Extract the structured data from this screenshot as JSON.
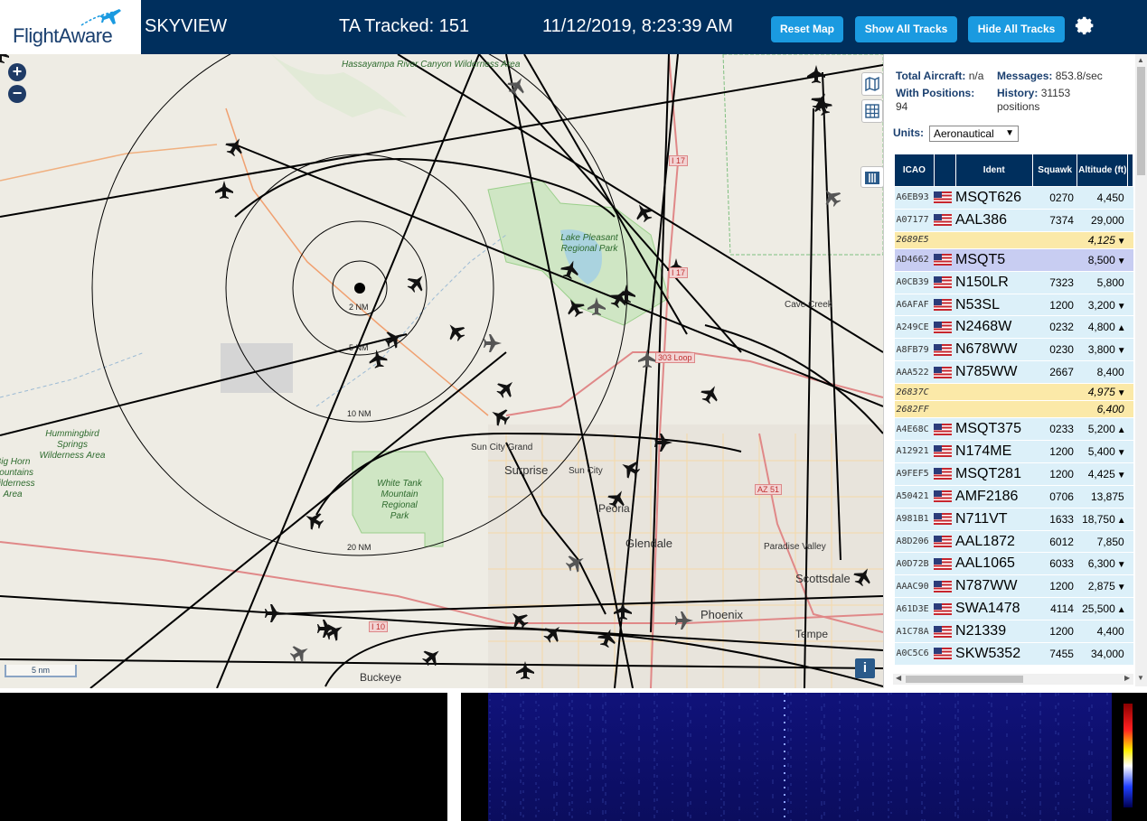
{
  "header": {
    "logo_text": "FlightAware",
    "app_name": "SKYVIEW",
    "ta_tracked": "TA Tracked: 151",
    "datetime": "11/12/2019, 8:23:39 AM",
    "buttons": {
      "reset_map": "Reset Map",
      "show_all_tracks": "Show All Tracks",
      "hide_all_tracks": "Hide All Tracks"
    },
    "settings_icon": "gear-icon"
  },
  "map": {
    "zoom_in": "+",
    "zoom_out": "−",
    "scale_label": "5 nm",
    "info_label": "i",
    "range_rings": [
      "2 NM",
      "5 NM",
      "10 NM",
      "20 NM"
    ],
    "places": {
      "sun_city_grand": "Sun City Grand",
      "surprise": "Surprise",
      "sun_city": "Sun City",
      "peoria": "Peoria",
      "glendale": "Glendale",
      "phoenix": "Phoenix",
      "scottsdale": "Scottsdale",
      "tempe": "Tempe",
      "paradise_valley": "Paradise Valley",
      "cave_creek": "Cave Creek",
      "buckeye": "Buckeye"
    },
    "parks": {
      "hassayampa": "Hassayampa River Canyon Wilderness Area",
      "lake_pleasant": "Lake Pleasant Regional Park",
      "white_tank": "White Tank Mountain Regional Park",
      "hummingbird": "Hummingbird Springs Wilderness Area",
      "big_horn": "Big Horn Mountains Wilderness Area"
    },
    "highways": {
      "i17_top": "I 17",
      "i17_mid": "I 17",
      "loop": "303 Loop",
      "az51": "AZ 51",
      "i10": "I 10"
    }
  },
  "stats": {
    "total_aircraft_label": "Total Aircraft:",
    "total_aircraft_value": "n/a",
    "messages_label": "Messages:",
    "messages_value": "853.8/sec",
    "with_positions_label": "With Positions:",
    "with_positions_value": "94",
    "history_label": "History:",
    "history_value": "31153 positions"
  },
  "units": {
    "label": "Units:",
    "selected": "Aeronautical"
  },
  "table": {
    "headers": [
      "ICAO",
      "",
      "Ident",
      "Squawk",
      "Altitude (ft)"
    ],
    "rows": [
      {
        "icao": "A6EB93",
        "ident": "MSQT626",
        "squawk": "0270",
        "alt": "4,450",
        "trend": "",
        "style": "normal",
        "flag": true
      },
      {
        "icao": "A07177",
        "ident": "AAL386",
        "squawk": "7374",
        "alt": "29,000",
        "trend": "",
        "style": "normal",
        "flag": true
      },
      {
        "icao": "2689E5",
        "ident": "",
        "squawk": "",
        "alt": "4,125",
        "trend": "▼",
        "style": "yellow",
        "flag": false
      },
      {
        "icao": "AD4662",
        "ident": "MSQT5",
        "squawk": "",
        "alt": "8,500",
        "trend": "▼",
        "style": "selected",
        "flag": true
      },
      {
        "icao": "A0CB39",
        "ident": "N150LR",
        "squawk": "7323",
        "alt": "5,800",
        "trend": "",
        "style": "normal",
        "flag": true
      },
      {
        "icao": "A6AFAF",
        "ident": "N53SL",
        "squawk": "1200",
        "alt": "3,200",
        "trend": "▼",
        "style": "normal",
        "flag": true
      },
      {
        "icao": "A249CE",
        "ident": "N2468W",
        "squawk": "0232",
        "alt": "4,800",
        "trend": "▲",
        "style": "normal",
        "flag": true
      },
      {
        "icao": "A8FB79",
        "ident": "N678WW",
        "squawk": "0230",
        "alt": "3,800",
        "trend": "▼",
        "style": "normal",
        "flag": true
      },
      {
        "icao": "AAA522",
        "ident": "N785WW",
        "squawk": "2667",
        "alt": "8,400",
        "trend": "",
        "style": "normal",
        "flag": true
      },
      {
        "icao": "26837C",
        "ident": "",
        "squawk": "",
        "alt": "4,975",
        "trend": "▼",
        "style": "yellow",
        "flag": false
      },
      {
        "icao": "2682FF",
        "ident": "",
        "squawk": "",
        "alt": "6,400",
        "trend": "",
        "style": "yellow",
        "flag": false
      },
      {
        "icao": "A4E68C",
        "ident": "MSQT375",
        "squawk": "0233",
        "alt": "5,200",
        "trend": "▲",
        "style": "normal",
        "flag": true
      },
      {
        "icao": "A12921",
        "ident": "N174ME",
        "squawk": "1200",
        "alt": "5,400",
        "trend": "▼",
        "style": "normal",
        "flag": true
      },
      {
        "icao": "A9FEF5",
        "ident": "MSQT281",
        "squawk": "1200",
        "alt": "4,425",
        "trend": "▼",
        "style": "normal",
        "flag": true
      },
      {
        "icao": "A50421",
        "ident": "AMF2186",
        "squawk": "0706",
        "alt": "13,875",
        "trend": "",
        "style": "normal",
        "flag": true
      },
      {
        "icao": "A981B1",
        "ident": "N711VT",
        "squawk": "1633",
        "alt": "18,750",
        "trend": "▲",
        "style": "normal",
        "flag": true
      },
      {
        "icao": "A8D206",
        "ident": "AAL1872",
        "squawk": "6012",
        "alt": "7,850",
        "trend": "",
        "style": "normal",
        "flag": true
      },
      {
        "icao": "A0D72B",
        "ident": "AAL1065",
        "squawk": "6033",
        "alt": "6,300",
        "trend": "▼",
        "style": "normal",
        "flag": true
      },
      {
        "icao": "AAAC90",
        "ident": "N787WW",
        "squawk": "1200",
        "alt": "2,875",
        "trend": "▼",
        "style": "normal",
        "flag": true
      },
      {
        "icao": "A61D3E",
        "ident": "SWA1478",
        "squawk": "4114",
        "alt": "25,500",
        "trend": "▲",
        "style": "normal",
        "flag": true
      },
      {
        "icao": "A1C78A",
        "ident": "N21339",
        "squawk": "1200",
        "alt": "4,400",
        "trend": "",
        "style": "normal",
        "flag": true
      },
      {
        "icao": "A0C5C6",
        "ident": "SKW5352",
        "squawk": "7455",
        "alt": "34,000",
        "trend": "",
        "style": "normal",
        "flag": true
      }
    ]
  },
  "colors": {
    "header_bg": "#002f5d",
    "button_bg": "#1a9ae0",
    "row_normal": "#dcf0f9",
    "row_yellow": "#fbe9a8",
    "row_selected": "#c8cdf2"
  }
}
